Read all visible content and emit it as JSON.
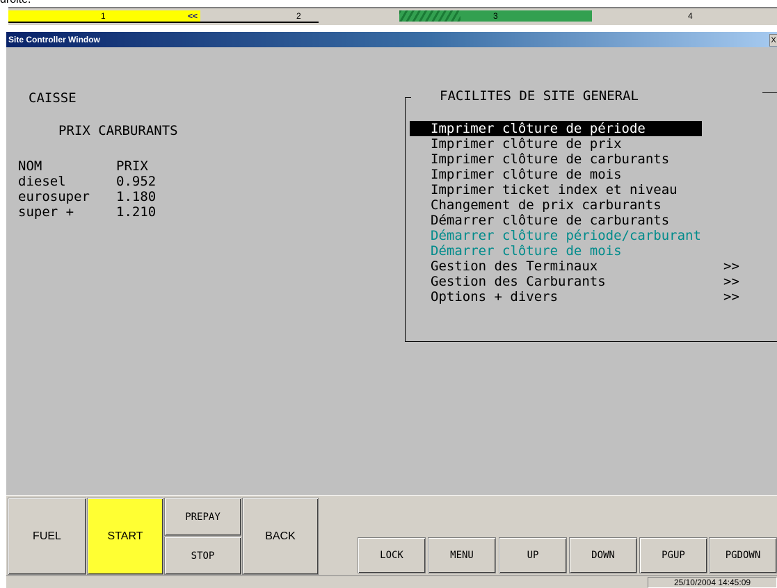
{
  "caption": "droite.",
  "pump_bar": {
    "segments": [
      {
        "label": "1",
        "indicator": "<<"
      },
      {
        "label": "2"
      },
      {
        "label": "3"
      },
      {
        "label": "4"
      }
    ]
  },
  "window": {
    "title": "Site Controller Window",
    "close_label": "X"
  },
  "left_panel": {
    "caisse": "CAISSE",
    "prices_title": "PRIX CARBURANTS",
    "col_name": "NOM",
    "col_price": "PRIX",
    "rows": [
      {
        "name": "diesel",
        "price": "0.952"
      },
      {
        "name": "eurosuper",
        "price": "1.180"
      },
      {
        "name": "super +",
        "price": "1.210"
      }
    ]
  },
  "menu": {
    "title": "FACILITES DE SITE GENERAL",
    "items": [
      {
        "label": "Imprimer clôture de période",
        "selected": true
      },
      {
        "label": "Imprimer clôture de prix"
      },
      {
        "label": "Imprimer clôture de carburants"
      },
      {
        "label": "Imprimer clôture de mois"
      },
      {
        "label": "Imprimer ticket index et niveau"
      },
      {
        "label": "Changement de prix carburants"
      },
      {
        "label": "Démarrer clôture de carburants"
      },
      {
        "label": "Démarrer clôture période/carburant",
        "disabled": true
      },
      {
        "label": "Démarrer clôture de mois",
        "disabled": true
      },
      {
        "label": "Gestion des Terminaux",
        "arrow": ">>"
      },
      {
        "label": "Gestion des Carburants",
        "arrow": ">>"
      },
      {
        "label": "Options + divers",
        "arrow": ">>"
      }
    ]
  },
  "buttons": {
    "fuel": "FUEL",
    "start": "START",
    "prepay": "PREPAY",
    "stop": "STOP",
    "back": "BACK",
    "lock": "LOCK",
    "menu": "MENU",
    "up": "UP",
    "down": "DOWN",
    "pgup": "PGUP",
    "pgdown": "PGDOWN"
  },
  "status": {
    "datetime": "25/10/2004 14:45:09"
  },
  "colors": {
    "pump1": "#ffff00",
    "pump3": "#33a050",
    "disabled_menu": "#008b8b",
    "start_button": "#ffff33"
  }
}
